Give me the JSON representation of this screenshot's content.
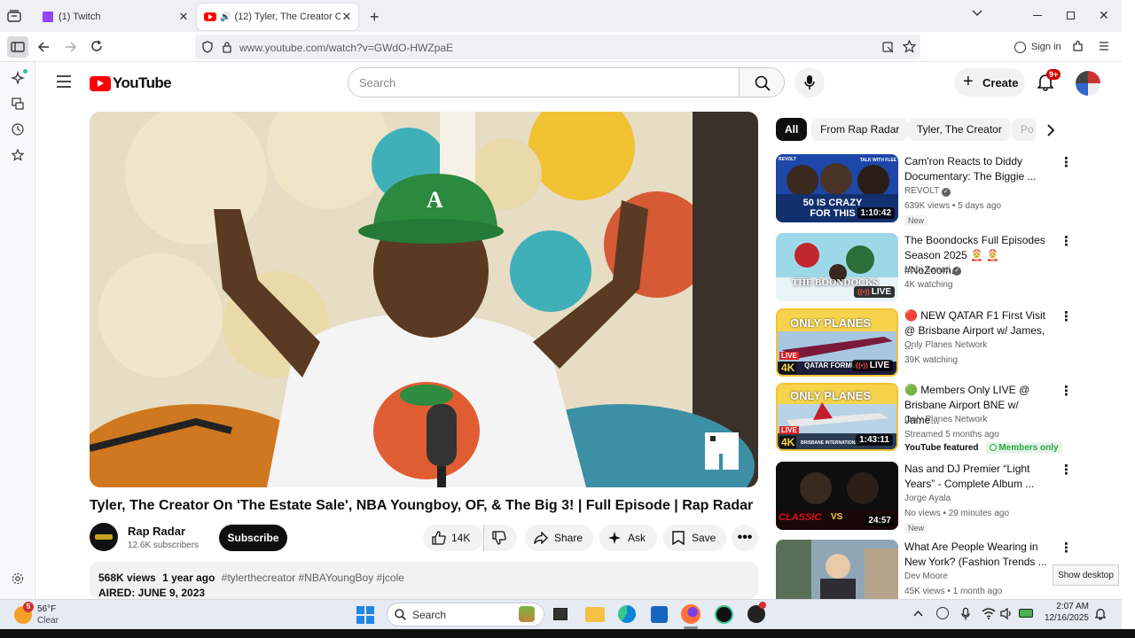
{
  "browser": {
    "tabs": [
      {
        "title": "(1) Twitch",
        "active": false
      },
      {
        "title": "(12) Tyler, The Creator On 'T",
        "active": true
      }
    ],
    "url": "www.youtube.com/watch?v=GWdO-HWZpaE",
    "sign_in": "Sign in"
  },
  "youtube": {
    "logo": "YouTube",
    "search_placeholder": "Search",
    "create_label": "Create",
    "notification_count": "9+"
  },
  "video": {
    "title": "Tyler, The Creator On 'The Estate Sale', NBA Youngboy, OF, & The Big 3! | Full Episode | Rap Radar",
    "channel": "Rap Radar",
    "subscribers": "12.6K subscribers",
    "subscribe_label": "Subscribe",
    "likes": "14K",
    "share_label": "Share",
    "ask_label": "Ask",
    "save_label": "Save",
    "views": "568K views",
    "age": "1 year ago",
    "hashtags": "#tylerthecreator #NBAYoungBoy #jcole",
    "desc_line2": "AIRED: JUNE 9, 2023",
    "watermark": "RAP"
  },
  "chips": [
    {
      "label": "All",
      "active": true
    },
    {
      "label": "From Rap Radar",
      "active": false
    },
    {
      "label": "Tyler, The Creator",
      "active": false
    },
    {
      "label": "Po",
      "active": false
    }
  ],
  "related": [
    {
      "title": "Cam'ron Reacts to Diddy Documentary: The Biggie ...",
      "channel": "REVOLT",
      "verified": true,
      "meta": "639K views • 5 days ago",
      "badge": "New",
      "duration": "1:10:42",
      "thumb_text": "50 IS CRAZY FOR THIS",
      "thumb_tag": "TALK WITH FLEE",
      "corner": "REVOLT"
    },
    {
      "title": "The Boondocks Full Episodes Season 2025 🤶 🤶 #NoZoom...",
      "channel": "Hobi Sanati",
      "verified": true,
      "meta": "4K watching",
      "badge": "",
      "live": "LIVE",
      "thumb_text": "THE BOONDOCKS"
    },
    {
      "title": "🔴 NEW QATAR F1 First Visit @ Brisbane Airport w/ James, ...",
      "channel": "Only Planes Network",
      "verified": false,
      "meta": "39K watching",
      "badge": "",
      "live": "LIVE",
      "thumb_text": "ONLY PLANES",
      "thumb_sub": "QATAR FORMULA 1",
      "thumb_tag": "LIVE",
      "thumb_4k": "4K"
    },
    {
      "title": "🟢 Members Only LIVE @ Brisbane Airport BNE w/ Jame...",
      "channel": "Only Planes Network",
      "verified": false,
      "meta": "Streamed 5 months ago",
      "badge": "",
      "featured": "YouTube featured",
      "members": "Members only",
      "duration": "1:43:11",
      "thumb_text": "ONLY PLANES",
      "thumb_tag": "LIVE",
      "thumb_4k": "4K",
      "thumb_sub": "BRISBANE INTERNATIONAL"
    },
    {
      "title": "Nas and DJ Premier “Light Years” - Complete Album ...",
      "channel": "Jorge Ayala",
      "verified": false,
      "meta": "No views • 29 minutes ago",
      "badge": "New",
      "duration": "24:57",
      "thumb_text": "CLASSIC",
      "thumb_vs": "VS"
    },
    {
      "title": "What Are People Wearing in New York? (Fashion Trends ...",
      "channel": "Dev Moore",
      "verified": false,
      "meta": "45K views • 1 month ago",
      "badge": ""
    }
  ],
  "taskbar": {
    "weather_temp": "56°F",
    "weather_desc": "Clear",
    "weather_badge": "5",
    "search_placeholder": "Search",
    "time": "2:07 AM",
    "date": "12/16/2025",
    "show_desktop": "Show desktop"
  },
  "colors": {
    "yt_red": "#ff0000",
    "accent_green": "#2ba640",
    "firefox_orange": "#ff7139"
  }
}
